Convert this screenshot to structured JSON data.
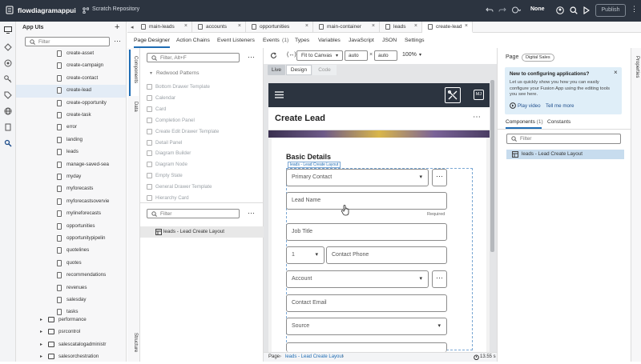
{
  "topbar": {
    "app_name": "flowdiagramappui",
    "breadcrumb": "Scratch Repository",
    "mode": "None",
    "publish_label": "Publish"
  },
  "tree": {
    "title": "App UIs",
    "filter_placeholder": "Filter",
    "items": [
      "create-asset",
      "create-campaign",
      "create-contact",
      "create-lead",
      "create-opportunity",
      "create-task",
      "error",
      "landing",
      "leads",
      "manage-saved-sea",
      "myday",
      "myforecasts",
      "myforecastsovervie",
      "mylineforecasts",
      "opportunities",
      "opportunitypipelin",
      "quotelines",
      "quotes",
      "recommendations",
      "revenues",
      "salesday",
      "tasks"
    ],
    "folders": [
      "performance",
      "psrcontrol",
      "salescatalogadministr",
      "salesorchestration"
    ]
  },
  "tabs": [
    "main-leads",
    "accounts",
    "opportunities",
    "main-container",
    "leads",
    "create-lead"
  ],
  "subtabs": [
    "Page Designer",
    "Action Chains",
    "Event Listeners",
    "Events",
    "(1)",
    "Types",
    "Variables",
    "JavaScript",
    "JSON",
    "Settings"
  ],
  "side_tabs": {
    "components": "Components",
    "data": "Data",
    "structure": "Structure",
    "properties": "Properties"
  },
  "palette": {
    "filter_placeholder": "Filter, Alt+F",
    "group": "Redwood Patterns",
    "items": [
      "Bottom Drawer Template",
      "Calendar",
      "Card",
      "Completion Panel",
      "Create Edit Drawer Template",
      "Detail Panel",
      "Diagram Builder",
      "Diagram Node",
      "Empty State",
      "General Drawer Template",
      "Hierarchy Card"
    ]
  },
  "structure": {
    "filter_placeholder": "Filter",
    "item": "leads - Lead Create Layout"
  },
  "canvas_toolbar": {
    "fit": "Fit to Canvas",
    "width": "auto",
    "height": "auto",
    "zoom": "100%",
    "views": [
      "Live",
      "Design",
      "Code"
    ]
  },
  "preview": {
    "avatar": "MJ",
    "page_title": "Create Lead",
    "section_title": "Basic Details",
    "layout_tag": "leads - Lead Create Layout",
    "primary_contact": "Primary Contact",
    "lead_name": "Lead Name",
    "required": "Required",
    "job_title": "Job Title",
    "phone_code": "1",
    "contact_phone": "Contact Phone",
    "account": "Account",
    "contact_email": "Contact Email",
    "source": "Source"
  },
  "right_panel": {
    "page_label": "Page",
    "page_badge": "Digital Sales",
    "info_title": "New to configuring applications?",
    "info_body": "Let us quickly show you how you can easily configure your Fusion App using the editing tools you see here.",
    "play_video": "Play video",
    "tell_me_more": "Tell me more",
    "tab_components": "Components",
    "tab_components_count": "(1)",
    "tab_constants": "Constants",
    "filter_placeholder": "Filter",
    "item": "leads - Lead Create Layout"
  },
  "bottom_bar": {
    "crumb1": "Page",
    "crumb2": "leads - Lead Create Layout",
    "timer": "13.55 s"
  },
  "colors": {
    "topbar": "#2c3440",
    "accent": "#1e6cb4",
    "info_bg": "#dfeef8",
    "selected": "#e3ecf6"
  }
}
